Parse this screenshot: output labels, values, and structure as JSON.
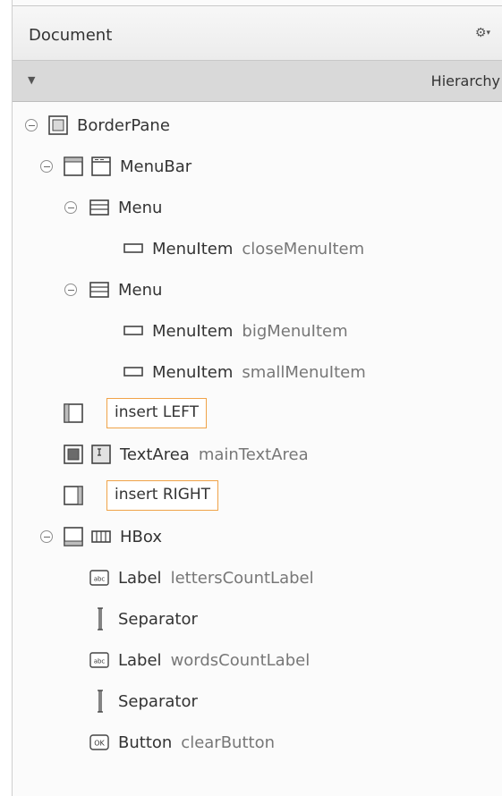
{
  "panel": {
    "title": "Document",
    "gear_caret": "▾"
  },
  "section": {
    "label": "Hierarchy",
    "arrow": "▼"
  },
  "tree": [
    {
      "type": "BorderPane",
      "fx_id": ""
    },
    {
      "type": "MenuBar",
      "fx_id": ""
    },
    {
      "type": "Menu",
      "fx_id": ""
    },
    {
      "type": "MenuItem",
      "fx_id": "closeMenuItem"
    },
    {
      "type": "Menu",
      "fx_id": ""
    },
    {
      "type": "MenuItem",
      "fx_id": "bigMenuItem"
    },
    {
      "type": "MenuItem",
      "fx_id": "smallMenuItem"
    },
    {
      "type": "insert LEFT",
      "fx_id": ""
    },
    {
      "type": "TextArea",
      "fx_id": "mainTextArea"
    },
    {
      "type": "insert RIGHT",
      "fx_id": ""
    },
    {
      "type": "HBox",
      "fx_id": ""
    },
    {
      "type": "Label",
      "fx_id": "lettersCountLabel"
    },
    {
      "type": "Separator",
      "fx_id": ""
    },
    {
      "type": "Label",
      "fx_id": "wordsCountLabel"
    },
    {
      "type": "Separator",
      "fx_id": ""
    },
    {
      "type": "Button",
      "fx_id": "clearButton"
    }
  ]
}
